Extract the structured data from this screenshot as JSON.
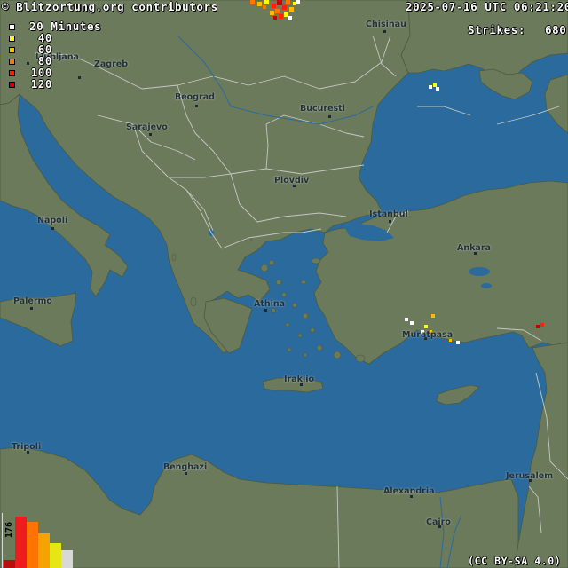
{
  "header": {
    "credit": "© Blitzortung.org contributors",
    "timestamp": "2025-07-16 UTC 06:21:20",
    "strikes_label": "Strikes:",
    "strikes_value": "680",
    "license": "(CC BY-SA 4.0)"
  },
  "legend": {
    "items": [
      {
        "label": "20 Minutes",
        "color": "#ffffff"
      },
      {
        "label": "40",
        "color": "#ffff00"
      },
      {
        "label": "60",
        "color": "#ffbb00"
      },
      {
        "label": "80",
        "color": "#ff7700"
      },
      {
        "label": "100",
        "color": "#ff2200"
      },
      {
        "label": "120",
        "color": "#cc0000"
      }
    ]
  },
  "histogram": {
    "peak_count": "176",
    "bars": [
      {
        "color": "#b80e0e",
        "level": 0.16
      },
      {
        "color": "#ee1c1c",
        "level": 1.0
      },
      {
        "color": "#ff7300",
        "level": 0.9
      },
      {
        "color": "#f5a300",
        "level": 0.68
      },
      {
        "color": "#e6e615",
        "level": 0.48
      },
      {
        "color": "#d8d8d8",
        "level": 0.35
      }
    ]
  },
  "map": {
    "cities": [
      {
        "name": "Chisinau"
      },
      {
        "name": "Ljubljana"
      },
      {
        "name": "Zagreb"
      },
      {
        "name": "Beograd"
      },
      {
        "name": "Bucuresti"
      },
      {
        "name": "Sarajevo"
      },
      {
        "name": "Plovdiv"
      },
      {
        "name": "Istanbul"
      },
      {
        "name": "Ankara"
      },
      {
        "name": "Napoli"
      },
      {
        "name": "Palermo"
      },
      {
        "name": "Athina"
      },
      {
        "name": "Muratpasa"
      },
      {
        "name": "Iraklio"
      },
      {
        "name": "Tripoli"
      },
      {
        "name": "Benghazi"
      },
      {
        "name": "Alexandria"
      },
      {
        "name": "Jerusalem"
      },
      {
        "name": "Cairo"
      }
    ],
    "colors": {
      "sea": "#2a6a9c",
      "land": "#6b7a5a",
      "border": "#c4c8c4"
    }
  }
}
